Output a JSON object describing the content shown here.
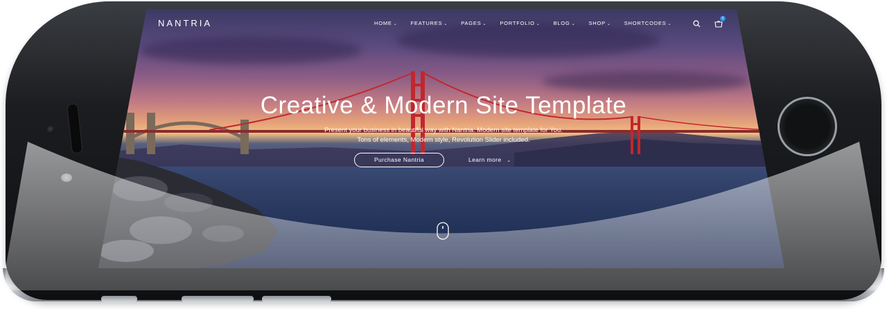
{
  "nav": {
    "logo": "NANTRIA",
    "items": [
      {
        "label": "HOME"
      },
      {
        "label": "FEATURES"
      },
      {
        "label": "PAGES"
      },
      {
        "label": "PORTFOLIO"
      },
      {
        "label": "BLOG"
      },
      {
        "label": "SHOP"
      },
      {
        "label": "SHORTCODES"
      }
    ],
    "cart_count": "0",
    "icons": {
      "search": "search-icon",
      "cart": "cart-icon",
      "chevron": "chevron-down-icon"
    }
  },
  "hero": {
    "title": "Creative & Modern Site Template",
    "subtitle_line1": "Present your business in beautiful way with Nantria. Modern site template for You.",
    "subtitle_line2": "Tons of elements, Modern style, Revolution Slider included.",
    "primary_button": "Purchase Nantria",
    "secondary_link": "Learn more",
    "scroll_icon": "mouse-scroll-icon"
  },
  "colors": {
    "accent": "#2f8de4",
    "bridge": "#c1272d",
    "text": "#ffffff",
    "phone_frame": "#1c1d20",
    "phone_rim": "#c9cdd3"
  }
}
